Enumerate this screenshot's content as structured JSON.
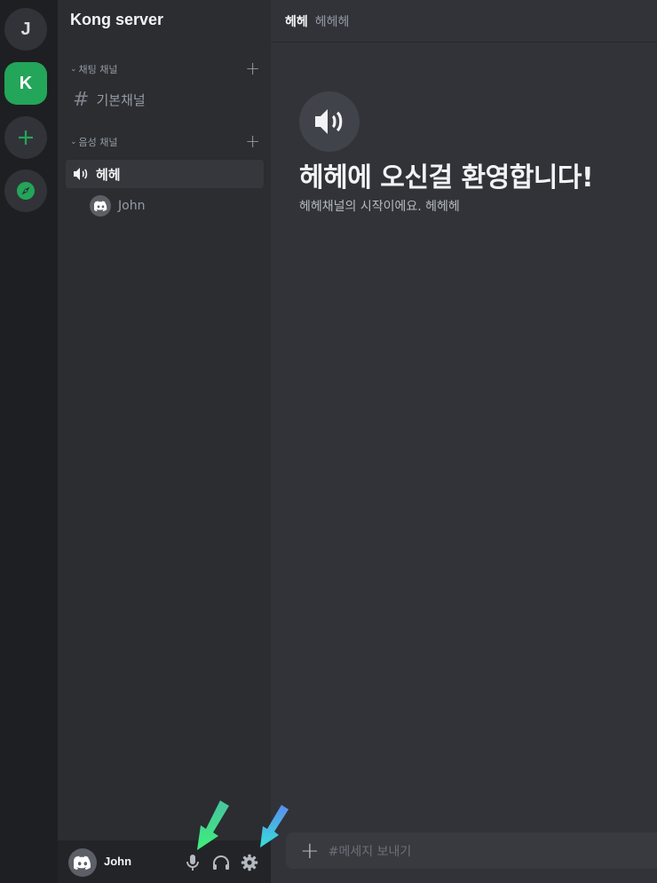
{
  "servers": {
    "items": [
      {
        "label": "J",
        "active": false
      },
      {
        "label": "K",
        "active": true
      }
    ],
    "add_icon": "plus-icon",
    "explore_icon": "compass-icon"
  },
  "sidebar": {
    "server_name": "Kong server",
    "categories": [
      {
        "label": "채팅 채널",
        "channels": [
          {
            "name": "기본채널",
            "type": "text"
          }
        ]
      },
      {
        "label": "음성 채널",
        "channels": [
          {
            "name": "헤헤",
            "type": "voice",
            "selected": true
          }
        ]
      }
    ],
    "voice_users": [
      {
        "name": "John"
      }
    ]
  },
  "user_panel": {
    "name": "John",
    "icons": [
      "microphone-icon",
      "headphones-icon",
      "gear-icon"
    ]
  },
  "main": {
    "channel_name": "헤헤",
    "channel_topic": "헤헤헤",
    "welcome_title": "헤헤에 오신걸 환영합니다!",
    "welcome_subtitle": "헤헤채널의 시작이에요. 헤헤헤",
    "composer_placeholder": "#메세지 보내기"
  },
  "colors": {
    "accent_green": "#23a55a",
    "arrow_green": "#3ee87a",
    "arrow_blue": "#3bc6e8"
  }
}
